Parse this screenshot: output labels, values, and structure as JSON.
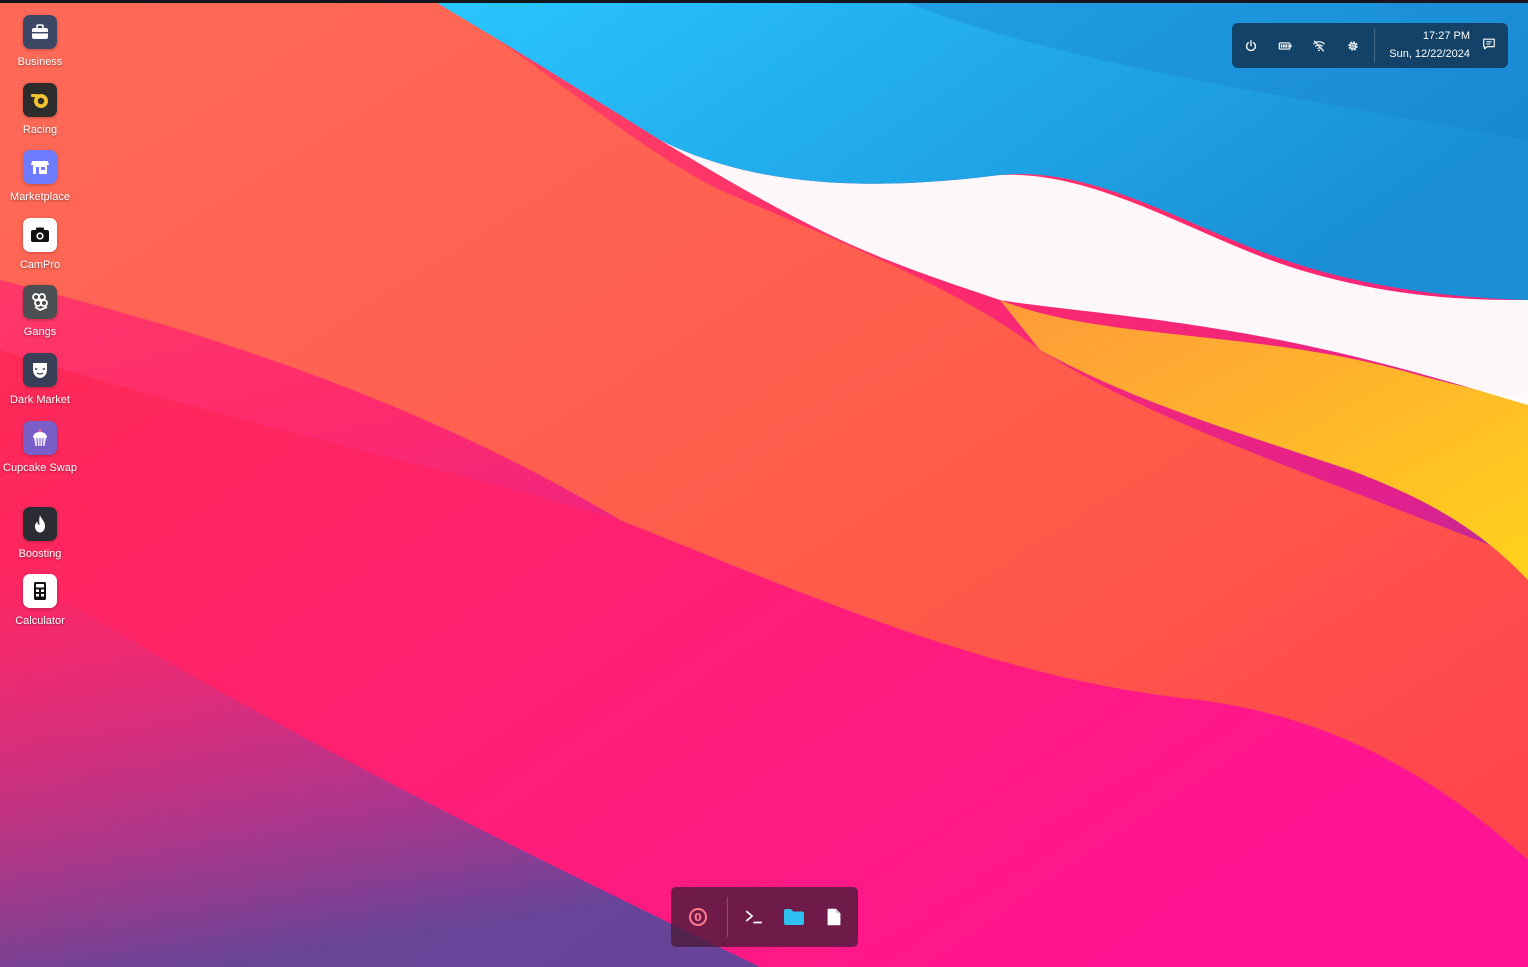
{
  "desktop": {
    "icons": [
      {
        "label": "Business",
        "icon": "briefcase-icon",
        "bg": "#3b4765"
      },
      {
        "label": "Racing",
        "icon": "turbo-icon",
        "bg": "#2c2c2c"
      },
      {
        "label": "Marketplace",
        "icon": "storefront-icon",
        "bg": "#6e7dff"
      },
      {
        "label": "CamPro",
        "icon": "camera-icon",
        "bg": "#ffffff"
      },
      {
        "label": "Gangs",
        "icon": "brass-knuckles-icon",
        "bg": "#4b4f52"
      },
      {
        "label": "Dark Market",
        "icon": "mask-icon",
        "bg": "#3a3f58"
      },
      {
        "label": "Cupcake Swap",
        "icon": "cupcake-icon",
        "bg": "#7b5dc8"
      },
      {
        "label": "Boosting",
        "icon": "flame-icon",
        "bg": "#2c2c34"
      },
      {
        "label": "Calculator",
        "icon": "calculator-icon",
        "bg": "#ffffff"
      }
    ]
  },
  "tray": {
    "time": "17:27 PM",
    "date": "Sun, 12/22/2024",
    "icons": [
      "power-icon",
      "battery-icon",
      "wifi-off-icon",
      "gear-icon",
      "notifications-icon"
    ]
  },
  "taskbar": {
    "launcher_badge": "0",
    "icons": [
      "launcher-icon",
      "terminal-icon",
      "folder-icon",
      "file-icon"
    ],
    "folder_color": "#2fc1f2"
  }
}
